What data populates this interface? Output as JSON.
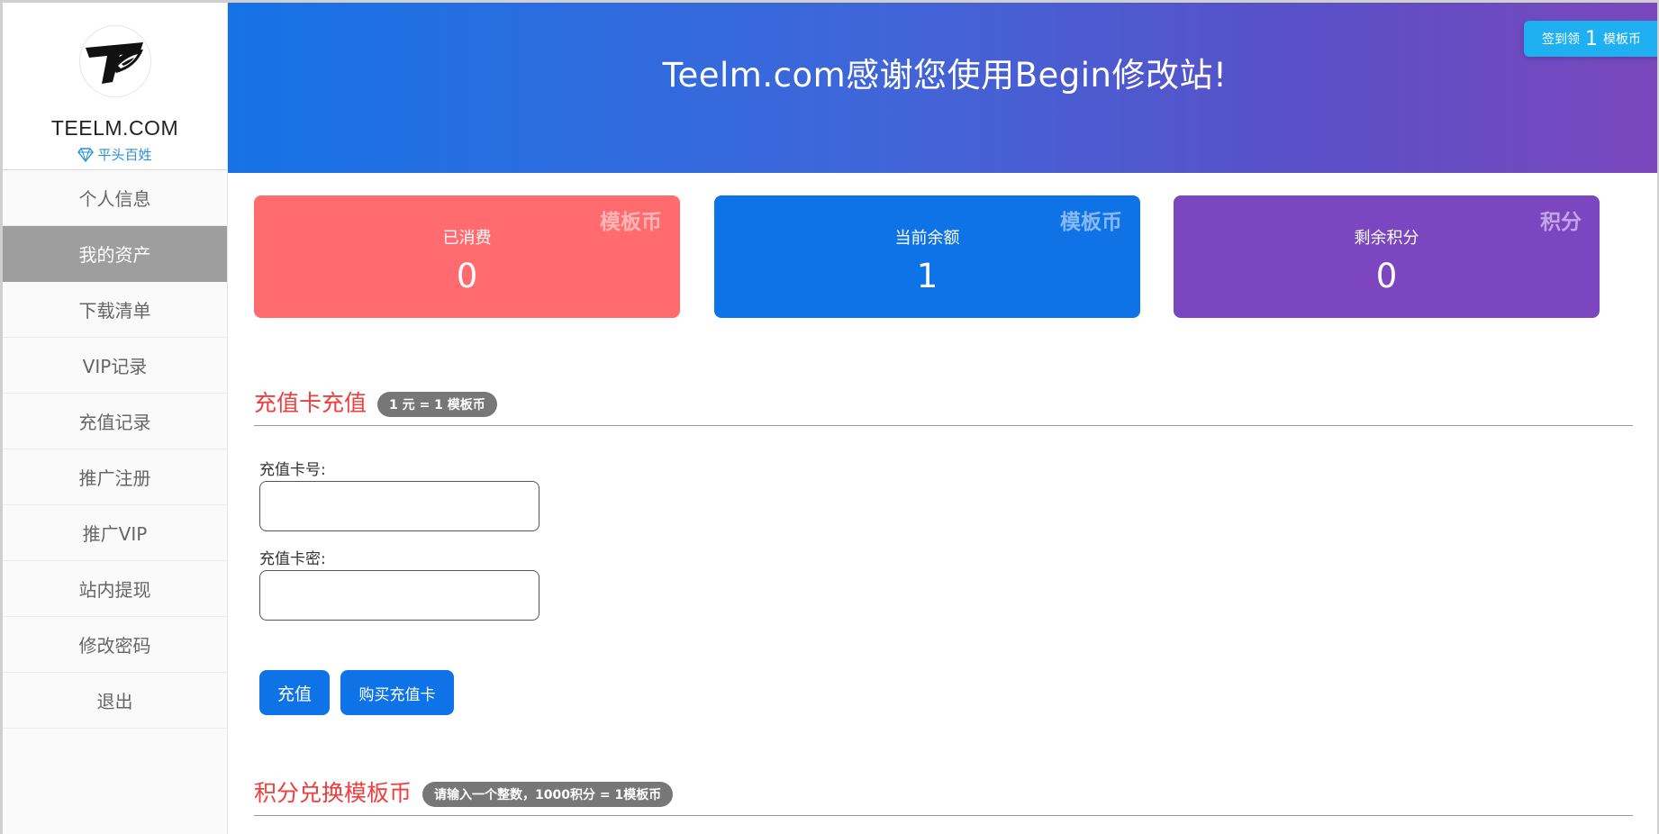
{
  "sidebar": {
    "site_name": "TEELM.COM",
    "user_level": "平头百姓",
    "items": [
      {
        "label": "个人信息",
        "active": false
      },
      {
        "label": "我的资产",
        "active": true
      },
      {
        "label": "下载清单",
        "active": false
      },
      {
        "label": "VIP记录",
        "active": false
      },
      {
        "label": "充值记录",
        "active": false
      },
      {
        "label": "推广注册",
        "active": false
      },
      {
        "label": "推广VIP",
        "active": false
      },
      {
        "label": "站内提现",
        "active": false
      },
      {
        "label": "修改密码",
        "active": false
      },
      {
        "label": "退出",
        "active": false
      }
    ]
  },
  "header": {
    "title": "Teelm.com感谢您使用Begin修改站!",
    "signin": {
      "prefix": "签到领",
      "amount": "1",
      "suffix": "模板币"
    }
  },
  "stats": [
    {
      "tag": "模板币",
      "label": "已消费",
      "value": "0",
      "color": "#ff6b6e"
    },
    {
      "tag": "模板币",
      "label": "当前余额",
      "value": "1",
      "color": "#0f73e8"
    },
    {
      "tag": "积分",
      "label": "剩余积分",
      "value": "0",
      "color": "#7b46c0"
    }
  ],
  "recharge": {
    "title": "充值卡充值",
    "rate": "1 元 = 1 模板币",
    "card_number_label": "充值卡号:",
    "card_number_value": "",
    "card_password_label": "充值卡密:",
    "card_password_value": "",
    "submit_label": "充值",
    "buy_label": "购买充值卡"
  },
  "exchange": {
    "title": "积分兑换模板币",
    "rate": "请输入一个整数，1000积分 = 1模板币"
  },
  "colors": {
    "accent_blue": "#0f73e8",
    "accent_red": "#ff6b6e",
    "accent_purple": "#7b46c0",
    "section_title": "#ef3e3e"
  }
}
